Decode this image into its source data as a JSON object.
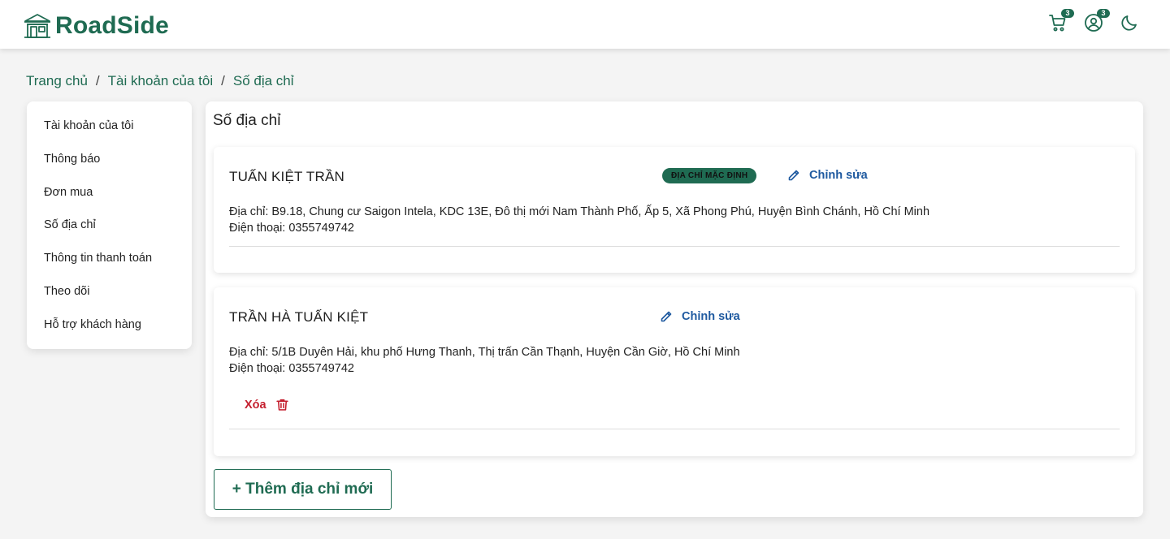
{
  "brand": {
    "name": "RoadSide",
    "color": "#1f6b52"
  },
  "header": {
    "cart_badge": "3",
    "account_badge": "3",
    "icons": [
      "cart-icon",
      "user-circle-icon",
      "moon-icon"
    ]
  },
  "breadcrumb": {
    "items": [
      "Trang chủ",
      "Tài khoản của tôi",
      "Số địa chỉ"
    ],
    "separator": "/"
  },
  "sidebar": {
    "items": [
      {
        "label": "Tài khoản của tôi"
      },
      {
        "label": "Thông báo"
      },
      {
        "label": "Đơn mua"
      },
      {
        "label": "Số địa chỉ"
      },
      {
        "label": "Thông tin thanh toán"
      },
      {
        "label": "Theo dõi"
      },
      {
        "label": "Hỗ trợ khách hàng"
      }
    ]
  },
  "main": {
    "title": "Số địa chỉ",
    "addresses": [
      {
        "name": "TUẤN KIỆT TRẦN",
        "default_badge": "ĐỊA CHỈ MẶC ĐỊNH",
        "edit_label": "Chỉnh sửa",
        "address": "Địa chỉ: B9.18, Chung cư Saigon Intela, KDC 13E, Đô thị mới Nam Thành Phố, Ấp 5, Xã Phong Phú, Huyện Bình Chánh, Hồ Chí Minh",
        "phone": "Điện thoại: 0355749742"
      },
      {
        "name": "TRẦN HÀ TUẤN KIỆT",
        "edit_label": "Chỉnh sửa",
        "address": "Địa chỉ: 5/1B Duyên Hải, khu phố Hưng Thanh, Thị trấn Cần Thạnh, Huyện Cần Giờ, Hồ Chí Minh",
        "phone": "Điện thoại: 0355749742",
        "delete_label": "Xóa"
      }
    ],
    "add_button": "+ Thêm địa chỉ mới"
  },
  "colors": {
    "accent": "#1f6b52",
    "link": "#1f5aa0",
    "danger": "#c41f2e"
  }
}
